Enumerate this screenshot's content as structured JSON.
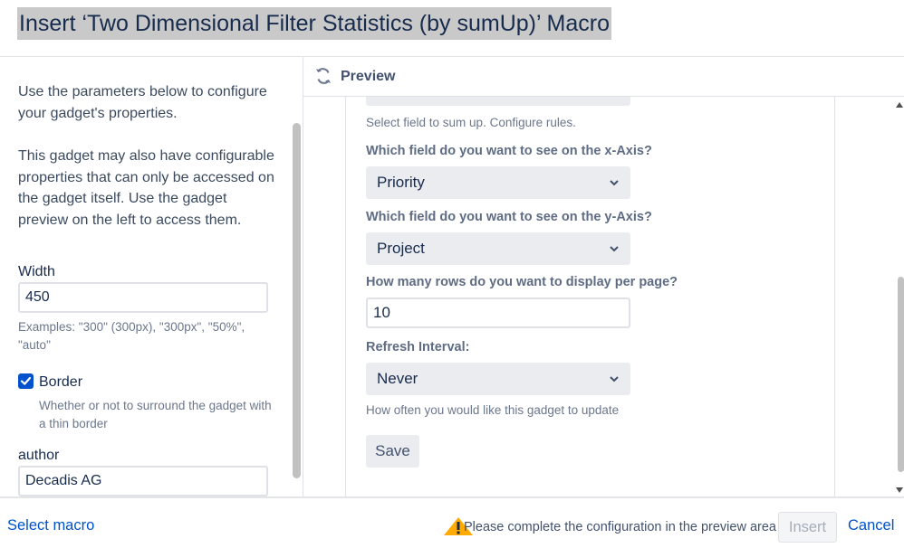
{
  "dialog": {
    "title": "Insert ‘Two Dimensional Filter Statistics (by sumUp)’ Macro"
  },
  "left_panel": {
    "cut_text": "                ",
    "intro": "Use the parameters below to configure your gadget's properties.",
    "note": "This gadget may also have configurable properties that can only be accessed on the gadget itself. Use the gadget preview on the left to access them.",
    "width": {
      "label": "Width",
      "value": "450",
      "hint": "Examples: \"300\" (300px), \"300px\", \"50%\", \"auto\""
    },
    "border": {
      "label": "Border",
      "checked": true,
      "hint": "Whether or not to surround the gadget with a thin border"
    },
    "author": {
      "label": "author",
      "value": "Decadis AG"
    }
  },
  "preview": {
    "label": "Preview",
    "sum_hint": "Select field to sum up. Configure rules.",
    "x_axis": {
      "question": "Which field do you want to see on the x-Axis?",
      "selected": "Priority"
    },
    "y_axis": {
      "question": "Which field do you want to see on the y-Axis?",
      "selected": "Project"
    },
    "rows": {
      "question": "How many rows do you want to display per page?",
      "value": "10"
    },
    "refresh": {
      "question": "Refresh Interval:",
      "selected": "Never",
      "hint": "How often you would like this gadget to update"
    },
    "save_label": "Save"
  },
  "footer": {
    "select_macro": "Select macro",
    "warning": "Please complete the configuration in the preview area first",
    "insert_label": "Insert",
    "cancel_label": "Cancel"
  },
  "colors": {
    "link": "#0052cc",
    "checkbox": "#0052cc",
    "select_bg": "#ebecf0",
    "warning": "#ffab00"
  },
  "icons": {
    "preview": "refresh-icon",
    "warning": "warning-icon",
    "select": "chevron-down-icon",
    "checkbox": "check-icon"
  }
}
